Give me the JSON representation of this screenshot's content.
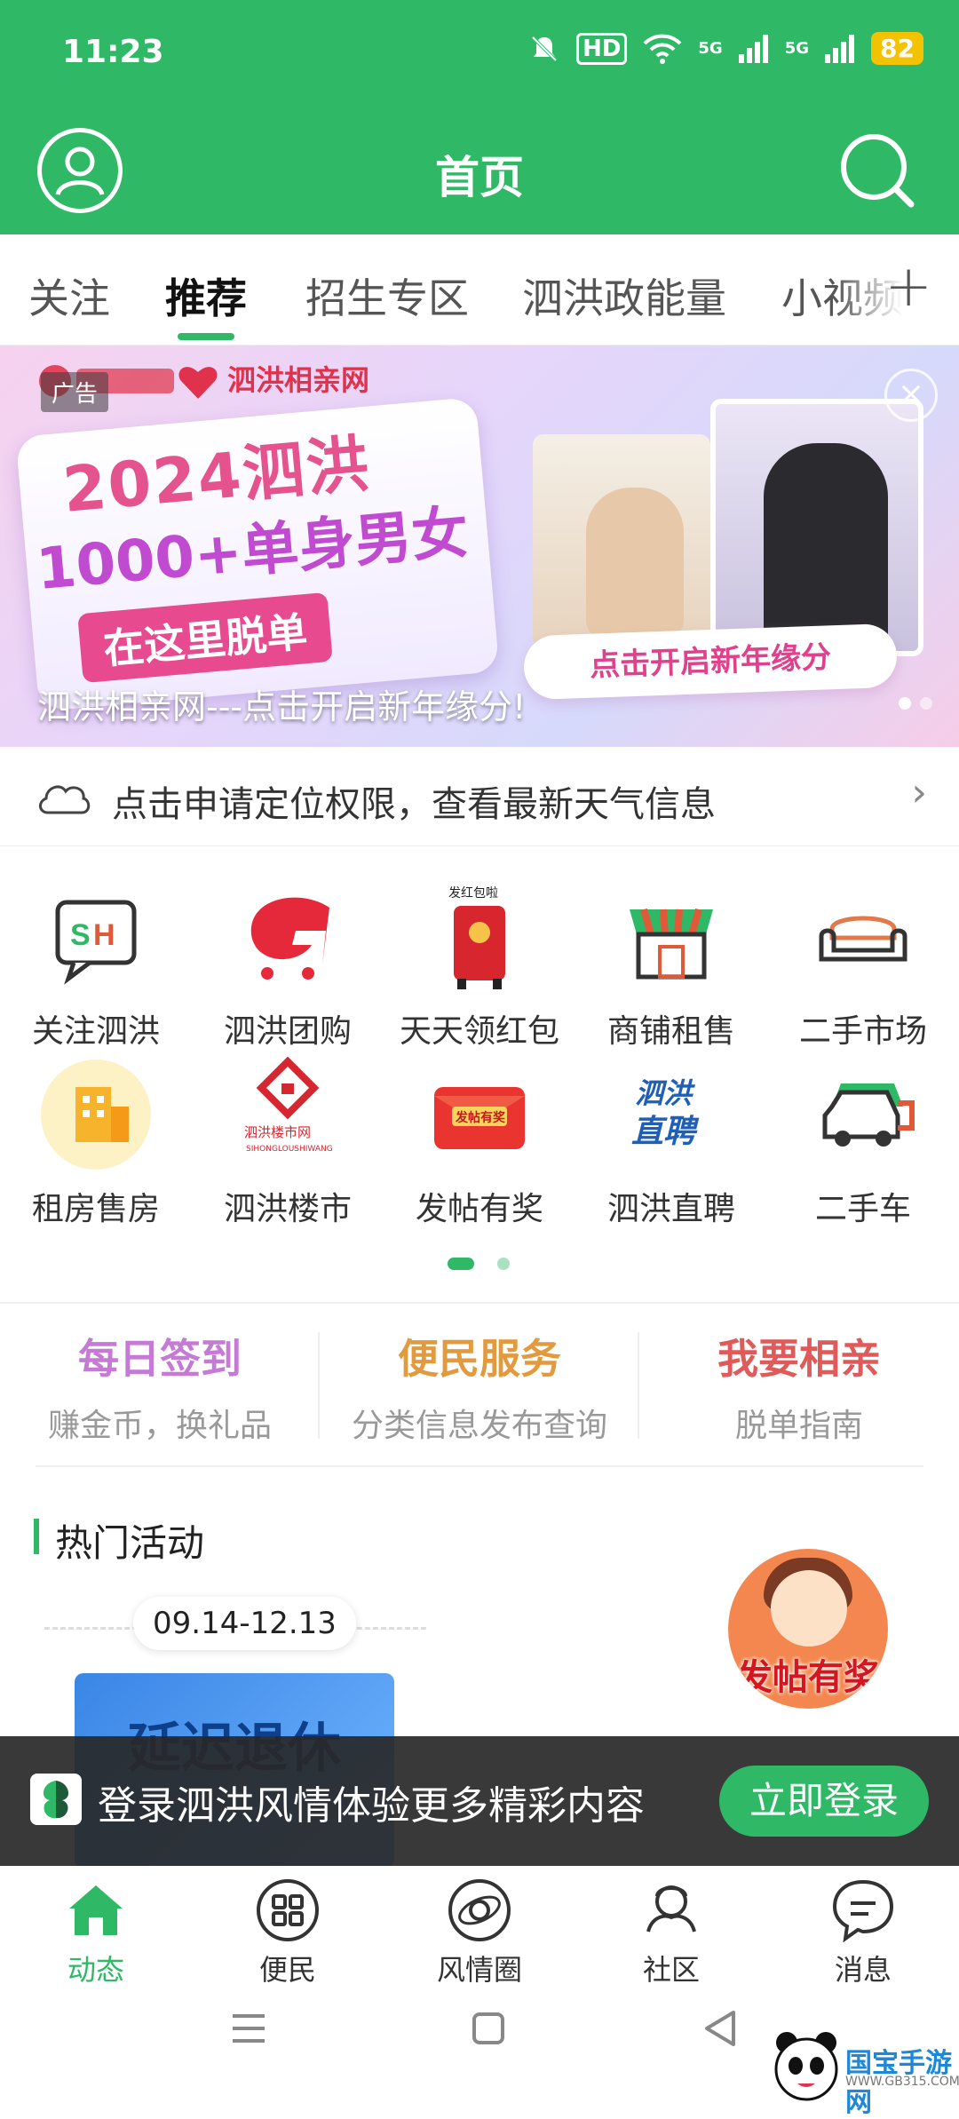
{
  "status_bar": {
    "time": "11:23",
    "battery": "82",
    "hd": "HD",
    "net1": "5G",
    "net2": "5G"
  },
  "header": {
    "title": "首页"
  },
  "tabs": [
    {
      "label": "关注"
    },
    {
      "label": "推荐"
    },
    {
      "label": "招生专区"
    },
    {
      "label": "泗洪政能量"
    },
    {
      "label": "小视频"
    }
  ],
  "banner": {
    "ad_label": "广告",
    "brand": "泗洪相亲网",
    "headline_1": "2024泗洪",
    "headline_2": "1000+单身男女",
    "headline_3": "在这里脱单",
    "cta": "点击开启新年缘分",
    "caption": "泗洪相亲网---点击开启新年缘分!"
  },
  "weather": {
    "text": "点击申请定位权限，查看最新天气信息"
  },
  "grid": [
    {
      "label": "关注泗洪",
      "icon": "sh-chat-icon"
    },
    {
      "label": "泗洪团购",
      "icon": "g-cart-icon"
    },
    {
      "label": "天天领红包",
      "icon": "red-envelope-icon"
    },
    {
      "label": "商铺租售",
      "icon": "shop-icon"
    },
    {
      "label": "二手市场",
      "icon": "sofa-icon"
    },
    {
      "label": "租房售房",
      "icon": "building-icon"
    },
    {
      "label": "泗洪楼市",
      "icon": "house-diamond-icon"
    },
    {
      "label": "发帖有奖",
      "icon": "prize-envelope-icon"
    },
    {
      "label": "泗洪直聘",
      "icon": "recruit-icon"
    },
    {
      "label": "二手车",
      "icon": "car-icon"
    }
  ],
  "services": [
    {
      "title": "每日签到",
      "sub": "赚金币，换礼品",
      "color": "#c57ad6"
    },
    {
      "title": "便民服务",
      "sub": "分类信息发布查询",
      "color": "#e29a3f"
    },
    {
      "title": "我要相亲",
      "sub": "脱单指南",
      "color": "#e05a5a"
    }
  ],
  "hot": {
    "title": "热门活动",
    "date": "09.14-12.13",
    "activity_text": "延迟退休",
    "promo_text": "发帖有奖"
  },
  "login_bar": {
    "text": "登录泗洪风情体验更多精彩内容",
    "button": "立即登录"
  },
  "bottom_nav": [
    {
      "label": "动态"
    },
    {
      "label": "便民"
    },
    {
      "label": "风情圈"
    },
    {
      "label": "社区"
    },
    {
      "label": "消息"
    }
  ],
  "watermark": {
    "title": "国宝手游网",
    "url": "WWW.GB315.COM"
  },
  "colors": {
    "brand_green": "#2fb866"
  }
}
